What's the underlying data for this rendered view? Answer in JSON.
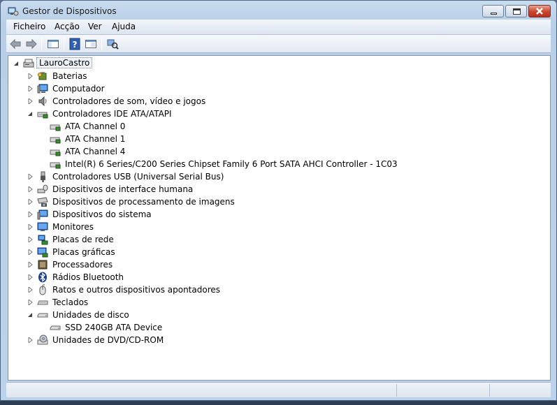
{
  "window": {
    "title": "Gestor de Dispositivos"
  },
  "menu": [
    "Ficheiro",
    "Acção",
    "Ver",
    "Ajuda"
  ],
  "toolbar": {
    "buttons": [
      "back-icon",
      "forward-icon",
      "show-hide-console-tree-icon",
      "help-icon",
      "properties-icon",
      "scan-hardware-icon"
    ]
  },
  "tree": {
    "root": "LauroCastro",
    "categories": [
      {
        "label": "Baterias",
        "icon": "battery-icon",
        "expanded": false
      },
      {
        "label": "Computador",
        "icon": "computer-icon",
        "expanded": false
      },
      {
        "label": "Controladores de som, vídeo e jogos",
        "icon": "speaker-icon",
        "expanded": false
      },
      {
        "label": "Controladores IDE ATA/ATAPI",
        "icon": "ide-controller-icon",
        "expanded": true,
        "children": [
          "ATA Channel 0",
          "ATA Channel 1",
          "ATA Channel 4",
          "Intel(R) 6 Series/C200 Series Chipset Family 6 Port SATA AHCI Controller - 1C03"
        ]
      },
      {
        "label": "Controladores USB (Universal Serial Bus)",
        "icon": "usb-icon",
        "expanded": false
      },
      {
        "label": "Dispositivos de interface humana",
        "icon": "hid-icon",
        "expanded": false
      },
      {
        "label": "Dispositivos de processamento de imagens",
        "icon": "camera-icon",
        "expanded": false
      },
      {
        "label": "Dispositivos do sistema",
        "icon": "system-device-icon",
        "expanded": false
      },
      {
        "label": "Monitores",
        "icon": "monitor-icon",
        "expanded": false
      },
      {
        "label": "Placas de rede",
        "icon": "network-icon",
        "expanded": false
      },
      {
        "label": "Placas gráficas",
        "icon": "display-adapter-icon",
        "expanded": false
      },
      {
        "label": "Processadores",
        "icon": "processor-icon",
        "expanded": false
      },
      {
        "label": "Rádios Bluetooth",
        "icon": "bluetooth-icon",
        "expanded": false
      },
      {
        "label": "Ratos e outros dispositivos apontadores",
        "icon": "mouse-icon",
        "expanded": false
      },
      {
        "label": "Teclados",
        "icon": "keyboard-icon",
        "expanded": false
      },
      {
        "label": "Unidades de disco",
        "icon": "disk-drive-icon",
        "expanded": true,
        "children": [
          "SSD 240GB ATA Device"
        ]
      },
      {
        "label": "Unidades de DVD/CD-ROM",
        "icon": "dvd-icon",
        "expanded": false
      }
    ]
  }
}
